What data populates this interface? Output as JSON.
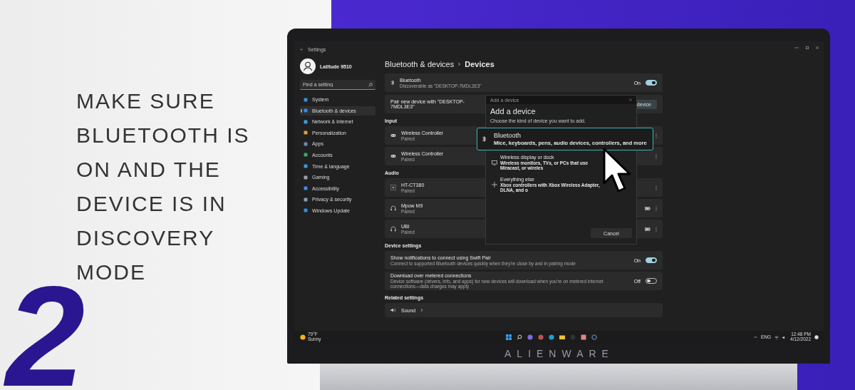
{
  "headline": "MAKE SURE BLUETOOTH IS ON AND THE DEVICE IS IN DISCOVERY MODE",
  "step_number": "2",
  "brand": "ALIENWARE",
  "settings": {
    "window_title": "Settings",
    "account_name": "Latitude 9510",
    "search": {
      "placeholder": "Find a setting"
    },
    "nav": [
      {
        "label": "System",
        "selected": false
      },
      {
        "label": "Bluetooth & devices",
        "selected": true
      },
      {
        "label": "Network & internet",
        "selected": false
      },
      {
        "label": "Personalization",
        "selected": false
      },
      {
        "label": "Apps",
        "selected": false
      },
      {
        "label": "Accounts",
        "selected": false
      },
      {
        "label": "Time & language",
        "selected": false
      },
      {
        "label": "Gaming",
        "selected": false
      },
      {
        "label": "Accessibility",
        "selected": false
      },
      {
        "label": "Privacy & security",
        "selected": false
      },
      {
        "label": "Windows Update",
        "selected": false
      }
    ],
    "breadcrumb": {
      "parent": "Bluetooth & devices",
      "current": "Devices"
    },
    "bluetooth_card": {
      "title": "Bluetooth",
      "subtitle": "Discoverable as \"DESKTOP-7MDL3E3\"",
      "toggle_label": "On",
      "on": true
    },
    "pair_card": {
      "label": "Pair new device with \"DESKTOP-7MDL3E3\"",
      "button": "device"
    },
    "device_sections": [
      {
        "heading": "Input",
        "devices": [
          {
            "kind": "controller",
            "name": "Wireless Controller",
            "status": "Paired",
            "battery": false
          },
          {
            "kind": "controller",
            "name": "Wireless Controller",
            "status": "Paired",
            "battery": false
          }
        ]
      },
      {
        "heading": "Audio",
        "devices": [
          {
            "kind": "speaker",
            "name": "HT-CT380",
            "status": "Paired",
            "battery": false
          },
          {
            "kind": "headphones",
            "name": "Mpow M9",
            "status": "Paired",
            "battery": true
          },
          {
            "kind": "headphones",
            "name": "UBI",
            "status": "Paired",
            "battery": true
          }
        ]
      }
    ],
    "device_settings": {
      "heading": "Device settings",
      "items": [
        {
          "title": "Show notifications to connect using Swift Pair",
          "description": "Connect to supported Bluetooth devices quickly when they're close by and in pairing mode",
          "toggle_label": "On",
          "on": true
        },
        {
          "title": "Download over metered connections",
          "description": "Device software (drivers, info, and apps) for new devices will download when you're on metered internet connections—data charges may apply",
          "toggle_label": "Off",
          "on": false
        }
      ]
    },
    "related": {
      "heading": "Related settings",
      "items": [
        {
          "label": "Sound"
        }
      ]
    },
    "dialog": {
      "title": "Add a device",
      "heading": "Add a device",
      "prompt": "Choose the kind of device you want to add.",
      "options": [
        {
          "kind": "bluetooth",
          "title": "Bluetooth",
          "description": "Mice, keyboards, pens, audio devices, controllers, and more",
          "selected": true
        },
        {
          "kind": "display",
          "title": "Wireless display or dock",
          "description": "Wireless monitors, TVs, or PCs that use Miracast, or wireles",
          "selected": false
        },
        {
          "kind": "other",
          "title": "Everything else",
          "description": "Xbox controllers with Xbox Wireless Adapter, DLNA, and o",
          "selected": false
        }
      ],
      "cancel": "Cancel"
    },
    "taskbar": {
      "temperature": "79°F",
      "condition": "Sunny",
      "language": "ENG",
      "time": "12:48 PM",
      "date": "4/12/2022"
    }
  }
}
